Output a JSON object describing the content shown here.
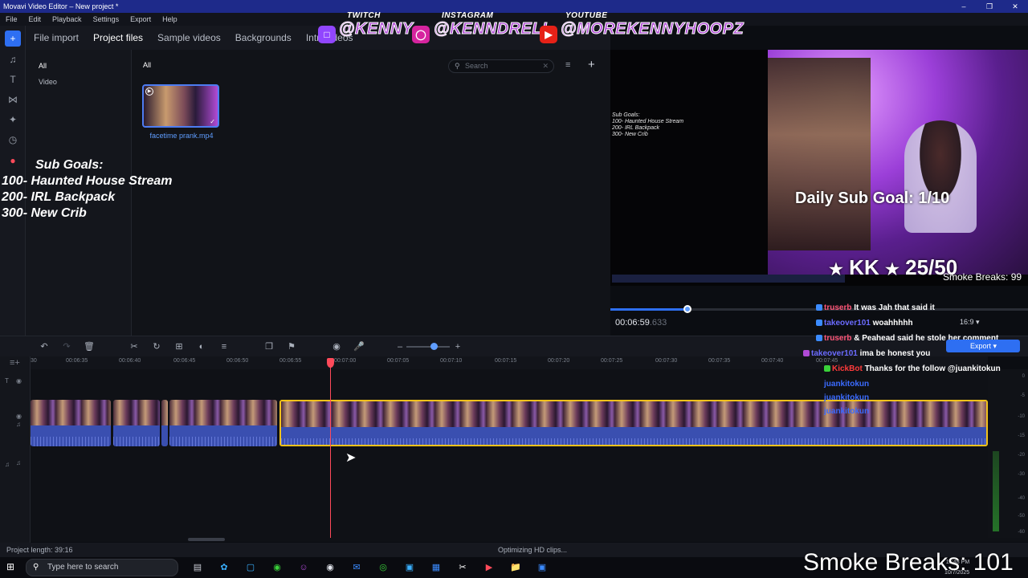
{
  "window": {
    "title": "Movavi Video Editor – New project *"
  },
  "menu": [
    "File",
    "Edit",
    "Playback",
    "Settings",
    "Export",
    "Help"
  ],
  "social": {
    "twitch": {
      "header": "TWITCH",
      "handle": "@KENNY"
    },
    "instagram": {
      "header": "INSTAGRAM",
      "handle": "@KENNDRELL"
    },
    "youtube": {
      "header": "YOUTUBE",
      "handle": "@MOREKENNYHOOPZ"
    }
  },
  "tabs": [
    "File import",
    "Project files",
    "Sample videos",
    "Backgrounds",
    "Intr... ideos"
  ],
  "active_tab": "Project files",
  "categories": [
    "All",
    "Video"
  ],
  "media": {
    "header": "All",
    "search_placeholder": "Search",
    "items": [
      {
        "name": "facetime prank.mp4"
      }
    ]
  },
  "subgoals_overlay": {
    "title": "Sub Goals:",
    "lines": [
      "100- Haunted House Stream",
      "200- IRL Backpack",
      "300- New Crib"
    ]
  },
  "preview": {
    "small_subgoals": [
      "Sub Goals:",
      "100- Haunted House Stream",
      "200- IRL Backpack",
      "300- New Crib"
    ],
    "daily_sub_goal": "Daily Sub Goal: 1/10",
    "kk_goal": "KK",
    "kk_count": "25/50",
    "smoke_breaks_small": "Smoke Breaks: 99",
    "timecode": "00:06:59",
    "timecode_frac": ".633",
    "aspect_ratio": "16:9",
    "scrub_progress": 0.185
  },
  "chat": [
    {
      "user": "truserb",
      "text": "It was Jah that said it",
      "color": "#ff5577"
    },
    {
      "user": "takeover101",
      "text": "woahhhhh",
      "color": "#6b6bff"
    },
    {
      "user": "truserb",
      "text": "& Peahead said he stole her comment",
      "color": "#ff5577"
    },
    {
      "user": "takeover101",
      "text": "ima be honest you",
      "color": "#6b6bff"
    },
    {
      "user": "KickBot",
      "text": "Thanks for the follow @juankitokun",
      "color": "#ff3b3b"
    },
    {
      "user": "juankitokun",
      "text": "",
      "color": "#3b6bff"
    },
    {
      "user": "juankitokun",
      "text": "",
      "color": "#3b6bff"
    },
    {
      "user": "juankitokun",
      "text": "",
      "color": "#3b6bff"
    }
  ],
  "export_label": "Export",
  "ruler_ticks": [
    "30",
    "00:06:35",
    "00:06:40",
    "00:06:45",
    "00:06:50",
    "00:06:55",
    "00:07:00",
    "00:07:05",
    "00:07:10",
    "00:07:15",
    "00:07:20",
    "00:07:25",
    "00:07:30",
    "00:07:35",
    "00:07:40",
    "00:07:45"
  ],
  "meter_labels": [
    "0",
    "-5",
    "-10",
    "-15",
    "-20",
    "-30",
    "-40",
    "-50",
    "-60"
  ],
  "status": {
    "project_length": "Project length: 39:16",
    "optimizing": "Optimizing HD clips..."
  },
  "taskbar": {
    "search_placeholder": "Type here to search",
    "time": "11:48 PM",
    "date": "10/7/2025"
  },
  "stream_overlay_footer": "Smoke Breaks: 101",
  "colors": {
    "accent": "#2e6ff2",
    "playhead": "#ff4a5a",
    "selection": "#f2c21b",
    "title_bar": "#1e2a8a"
  }
}
